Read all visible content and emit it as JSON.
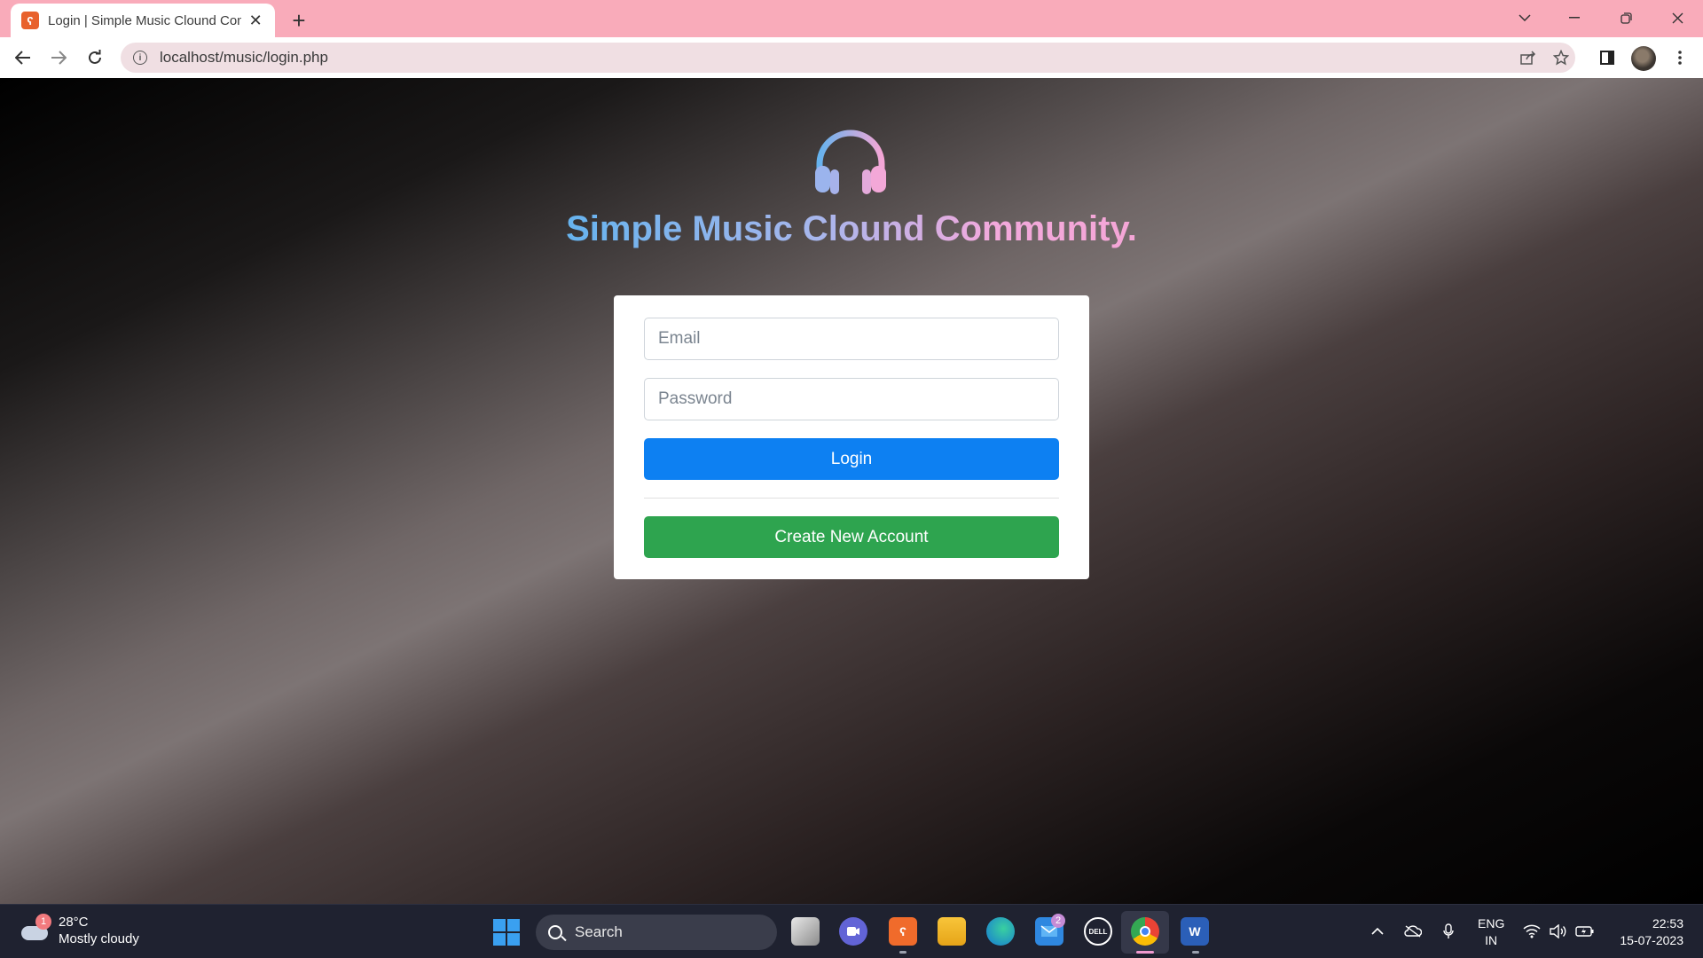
{
  "browser": {
    "tab_title": "Login | Simple Music Clound Community",
    "favicon_glyph": "ʕ",
    "new_tab_glyph": "+",
    "close_glyph": "✕",
    "url": "localhost/music/login.php",
    "icons": [
      "back-arrow-icon",
      "forward-arrow-icon",
      "reload-icon",
      "info-icon",
      "share-icon",
      "star-icon",
      "sidepanel-icon",
      "profile-avatar",
      "kebab-menu-icon"
    ]
  },
  "brand": {
    "title": "Simple Music Clound Community.",
    "logo_icon": "headphones-icon",
    "gradient": [
      "#66b3ee",
      "#f4a6d6"
    ]
  },
  "login_form": {
    "email_placeholder": "Email",
    "password_placeholder": "Password",
    "login_label": "Login",
    "create_label": "Create New Account",
    "colors": {
      "login": "#0d80f2",
      "create": "#2ea44f"
    }
  },
  "taskbar": {
    "weather_temp": "28°C",
    "weather_desc": "Mostly cloudy",
    "weather_badge": "1",
    "search_label": "Search",
    "mail_badge": "2",
    "lang_line1": "ENG",
    "lang_line2": "IN",
    "time": "22:53",
    "date": "15-07-2023"
  }
}
